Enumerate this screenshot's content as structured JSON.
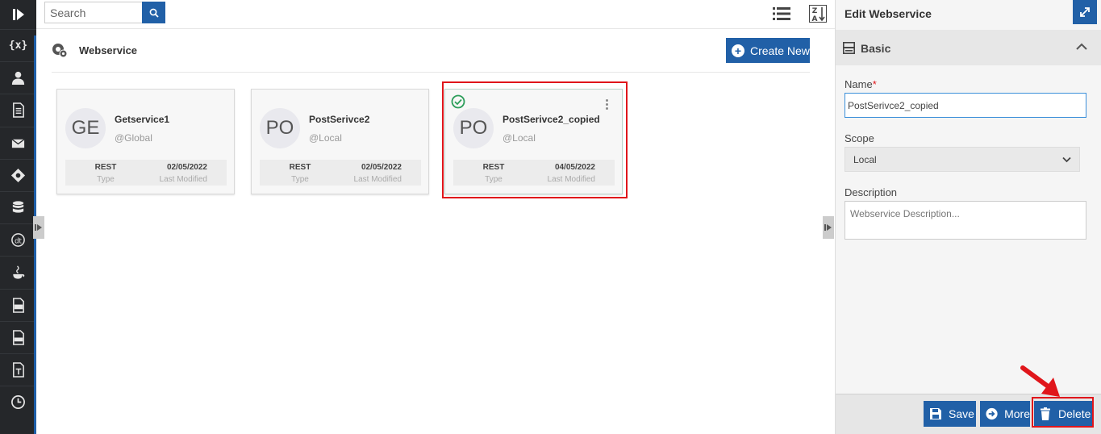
{
  "colors": {
    "rail": "#25272a",
    "accent": "#2160a7",
    "highlight": "#e0161b",
    "check": "#2e9e5b"
  },
  "search": {
    "placeholder": "Search"
  },
  "page": {
    "title": "Webservice",
    "create_label": "Create New"
  },
  "cards": [
    {
      "initials": "GE",
      "name": "Getservice1",
      "scope": "@Global",
      "type": "REST",
      "type_label": "Type",
      "modified": "02/05/2022",
      "modified_label": "Last Modified",
      "selected": false
    },
    {
      "initials": "PO",
      "name": "PostSerivce2",
      "scope": "@Local",
      "type": "REST",
      "type_label": "Type",
      "modified": "02/05/2022",
      "modified_label": "Last Modified",
      "selected": false
    },
    {
      "initials": "PO",
      "name": "PostSerivce2_copied",
      "scope": "@Local",
      "type": "REST",
      "type_label": "Type",
      "modified": "04/05/2022",
      "modified_label": "Last Modified",
      "selected": true
    }
  ],
  "panel": {
    "title": "Edit Webservice",
    "section": "Basic",
    "name_label": "Name",
    "required_mark": "*",
    "name_value": "PostSerivce2_copied",
    "scope_label": "Scope",
    "scope_value": "Local",
    "description_label": "Description",
    "description_placeholder": "Webservice Description...",
    "save_label": "Save",
    "more_label": "More",
    "delete_label": "Delete"
  },
  "rail_icons": [
    "variable-icon",
    "user-icon",
    "document-icon",
    "mail-icon",
    "diamond-icon",
    "database-icon",
    "dt-icon",
    "java-icon",
    "tb-icon",
    "css-icon",
    "text-icon",
    "clock-icon"
  ],
  "rail_text": {
    "variable": "{x}"
  }
}
